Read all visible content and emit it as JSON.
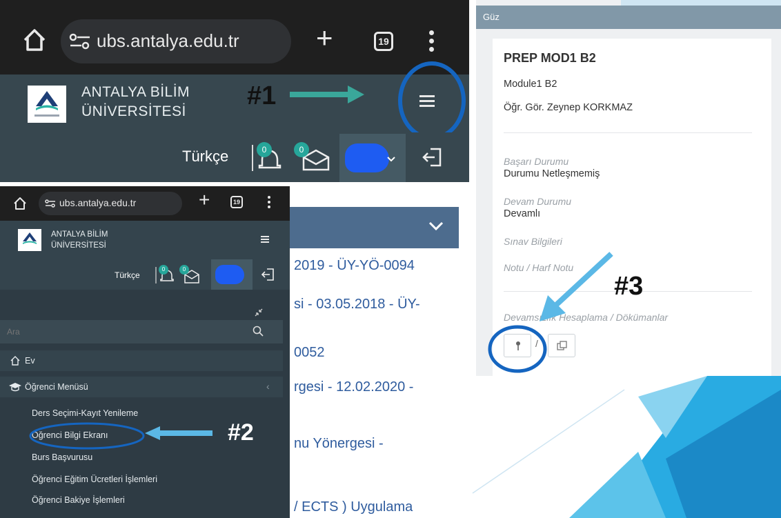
{
  "panel1": {
    "url": "ubs.antalya.edu.tr",
    "tab_count": "19",
    "university_line1": "ANTALYA BİLİM",
    "university_line2": "ÜNİVERSİTESİ",
    "language": "Türkçe",
    "notification_count": "0",
    "message_count": "0",
    "annotation": "#1"
  },
  "panel2": {
    "url": "ubs.antalya.edu.tr",
    "tab_count": "19",
    "university_line1": "ANTALYA BİLİM",
    "university_line2": "ÜNİVERSİTESİ",
    "language": "Türkçe",
    "notification_count": "0",
    "message_count": "0",
    "search_placeholder": "Ara",
    "menu": {
      "home": "Ev",
      "student_menu": "Öğrenci Menüsü",
      "items": [
        "Ders Seçimi-Kayıt Yenileme",
        "Öğrenci Bilgi Ekranı",
        "Burs Başvurusu",
        "Öğrenci Eğitim Ücretleri İşlemleri",
        "Öğrenci Bakiye İşlemleri"
      ]
    },
    "annotation": "#2"
  },
  "panel3": {
    "lines": [
      "2019 - ÜY-YÖ-0094",
      "si - 03.05.2018 - ÜY-",
      "0052",
      "rgesi - 12.02.2020 -",
      "nu Yönergesi -",
      "/ ECTS ) Uygulama"
    ]
  },
  "panel4": {
    "term": "Güz",
    "course_code": "PREP MOD1 B2",
    "course_name": "Module1 B2",
    "instructor": "Öğr. Gör. Zeynep KORKMAZ",
    "success_label": "Başarı Durumu",
    "success_value": "Durumu Netleşmemiş",
    "attendance_label": "Devam Durumu",
    "attendance_value": "Devamlı",
    "exam_label": "Sınav Bilgileri",
    "grade_label": "Notu / Harf Notu",
    "absence_label": "Devamsızlık Hesaplama / Dökümanlar",
    "annotation": "#3"
  },
  "colors": {
    "dark_bar": "#37474f",
    "menu_bg": "#2e3b44",
    "badge": "#26a69a",
    "highlight_circle": "#1565c0",
    "arrow_teal": "#3aa79a",
    "arrow_blue": "#5bb8e6",
    "section_header": "#4d6c8e"
  }
}
